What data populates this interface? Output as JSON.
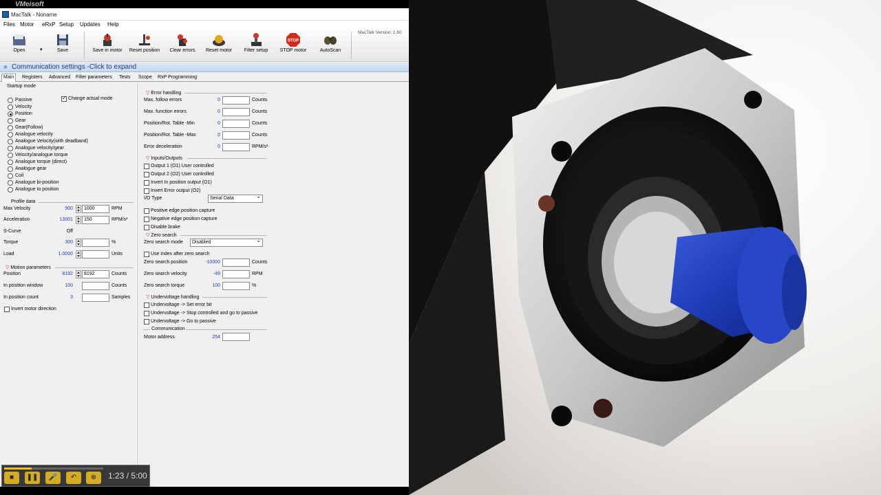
{
  "window": {
    "title": "MacTalk - Noname",
    "watermark": "VMeisoft"
  },
  "menu": [
    "Files",
    "Motor",
    "eRxP",
    "Setup",
    "Updates",
    "Help"
  ],
  "toolbar": {
    "open": "Open",
    "save": "Save",
    "save_in_motor": "Save in motor",
    "reset_position": "Reset position",
    "clear_errors": "Clear errors",
    "reset_motor": "Reset motor",
    "filter_setup": "Filter setup",
    "stop_motor": "STOP motor",
    "stop_icon_text": "STOP",
    "autoscan": "AutoScan",
    "version": "MacTalk Version: 1.60"
  },
  "comm_bar": {
    "arrow": "»",
    "text": "Communication settings -Click to expand"
  },
  "tabs": [
    "Main",
    "Registers",
    "Advanced",
    "Filter parameters",
    "Tests",
    "Scope",
    "RxP Programming"
  ],
  "startup_mode": {
    "title": "Startup mode",
    "options": [
      "Passive",
      "Velocity",
      "Position",
      "Gear",
      "Gear(Follow)",
      "Analogue velocity",
      "Analogue Velocity(with deadband)",
      "Analogue velocity/gear",
      "Velocity/analogue torque",
      "Analogue torque  (direct)",
      "Analogue gear",
      "Coil",
      "Analogue bi-position",
      "Analogue to position"
    ],
    "selected": "Position",
    "change_actual_mode": "Change actual mode"
  },
  "profile": {
    "title": "Profile data",
    "rows": [
      {
        "label": "Max Velocity",
        "value": "900",
        "input": "1000",
        "unit": "RPM"
      },
      {
        "label": "Acceleration",
        "value": "13001",
        "input": "150",
        "unit": "RPM/s²"
      },
      {
        "label": "S-Curve",
        "value": "Off",
        "input": "",
        "unit": ""
      },
      {
        "label": "Torque",
        "value": "300",
        "input": "",
        "unit": "%"
      },
      {
        "label": "Load",
        "value": "1.0000",
        "input": "",
        "unit": "Units"
      }
    ]
  },
  "motion": {
    "title": "Motion parameters",
    "rows": [
      {
        "label": "Position",
        "value": "8192",
        "input": "8192",
        "unit": "Counts"
      },
      {
        "label": "In position window",
        "value": "100",
        "input": "",
        "unit": "Counts"
      },
      {
        "label": "In position count",
        "value": "3",
        "input": "",
        "unit": "Samples"
      }
    ],
    "invert": "Invert motor direction"
  },
  "errors": {
    "title": "Error handling",
    "rows": [
      {
        "label": "Max. follow errors",
        "value": "0",
        "unit": "Counts"
      },
      {
        "label": "Max. function errors",
        "value": "0",
        "unit": "Counts"
      },
      {
        "label": "Position/Rot. Table -Min",
        "value": "0",
        "unit": "Counts"
      },
      {
        "label": "Position/Rot. Table -Max",
        "value": "0",
        "unit": "Counts"
      },
      {
        "label": "Error deceleration",
        "value": "0",
        "unit": "RPM/s²"
      }
    ]
  },
  "io": {
    "title": "Inputs/Outputs",
    "checks": [
      "Output 1 (O1) User controlled",
      "Output 2 (O2) User controlled",
      "Invert In position output (O1)",
      "Invert Error output (O2)"
    ],
    "io_type_label": "I/O Type",
    "io_type_value": "Serial Data",
    "capture": [
      "Positive edge position capture",
      "Negative edge position capture",
      "Disable brake"
    ]
  },
  "zero": {
    "title": "Zero search",
    "mode_label": "Zero search mode",
    "mode_value": "Disabled",
    "use_index": "Use index after zero search",
    "rows": [
      {
        "label": "Zero search position",
        "value": "-10000",
        "unit": "Counts"
      },
      {
        "label": "Zero search velocity",
        "value": "-49",
        "unit": "RPM"
      },
      {
        "label": "Zero search torque",
        "value": "100",
        "unit": "%"
      }
    ]
  },
  "undervoltage": {
    "title": "Undervoltage handling",
    "checks": [
      "Undervoltage -> Set error bit",
      "Undervoltage -> Stop controlled and go to passive",
      "Undervoltage -> Go to passive"
    ]
  },
  "communication": {
    "title": "Communication",
    "label": "Motor address",
    "value": "254"
  },
  "player": {
    "time": "1:23 / 5:00",
    "progress": 0.277
  }
}
